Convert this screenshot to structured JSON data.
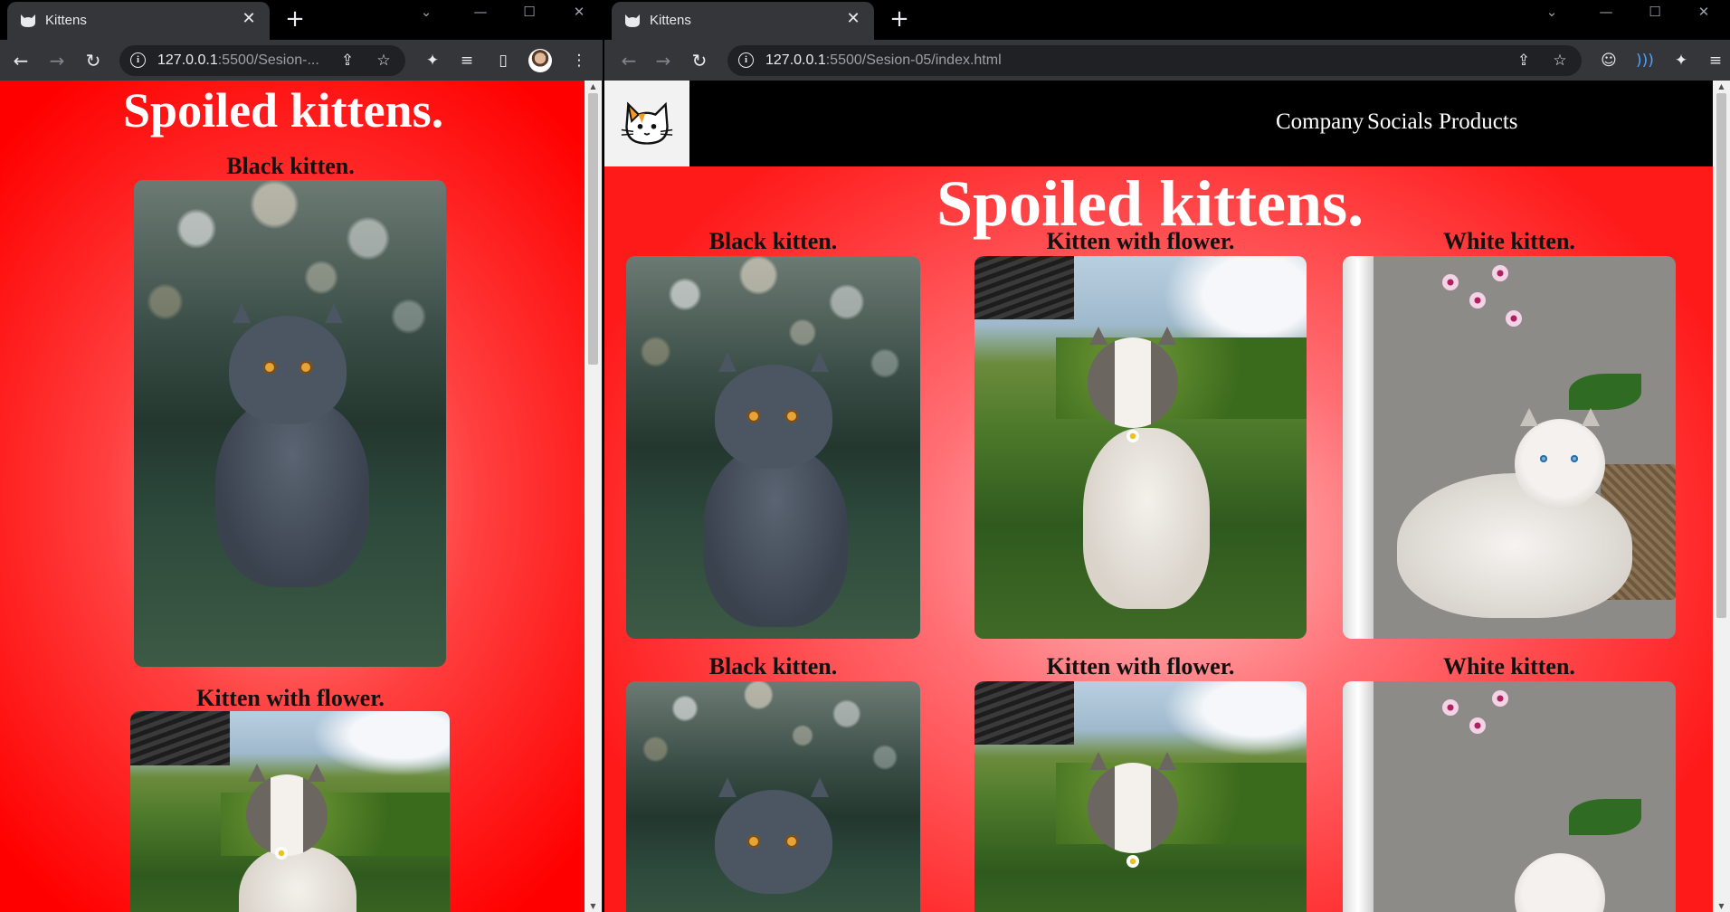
{
  "left_window": {
    "tab_title": "Kittens",
    "url_host": "127.0.0.1",
    "url_rest": ":5500/Sesion-...",
    "page": {
      "heading": "Spoiled kittens.",
      "cards": [
        {
          "caption": "Black kitten.",
          "image": "black-kitten"
        },
        {
          "caption": "Kitten with flower.",
          "image": "kitten-with-flower"
        }
      ]
    }
  },
  "right_window": {
    "tab_title": "Kittens",
    "url_host": "127.0.0.1",
    "url_rest": ":5500/Sesion-05/index.html",
    "page": {
      "nav_links": [
        "Company",
        "Socials",
        "Products"
      ],
      "heading": "Spoiled kittens.",
      "rows": [
        [
          {
            "caption": "Black kitten.",
            "image": "black-kitten"
          },
          {
            "caption": "Kitten with flower.",
            "image": "kitten-with-flower"
          },
          {
            "caption": "White kitten.",
            "image": "white-kitten"
          }
        ],
        [
          {
            "caption": "Black kitten.",
            "image": "black-kitten"
          },
          {
            "caption": "Kitten with flower.",
            "image": "kitten-with-flower"
          },
          {
            "caption": "White kitten.",
            "image": "white-kitten"
          }
        ]
      ]
    }
  },
  "icons": {
    "tab_favicon": "cat-face-icon",
    "site_logo": "cat-logo-icon",
    "toolbar": [
      "back-arrow-icon",
      "forward-arrow-icon",
      "reload-icon",
      "site-info-icon",
      "share-icon",
      "bookmark-star-icon",
      "extensions-puzzle-icon",
      "media-queue-icon",
      "side-panel-icon",
      "profile-avatar",
      "more-menu-icon"
    ]
  },
  "colors": {
    "page_red": "#ff0000",
    "page_center_pink": "#ffc2c4",
    "navbar": "#000000",
    "heading_text": "#ffffff",
    "caption_text": "#111111"
  }
}
